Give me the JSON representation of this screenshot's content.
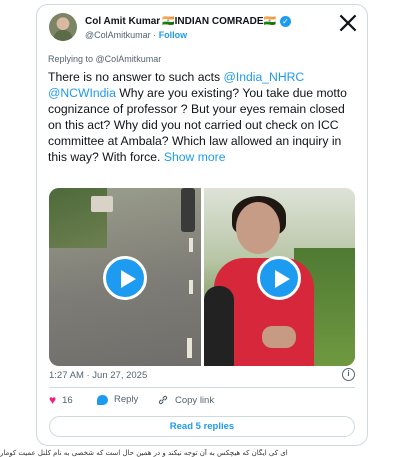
{
  "author": {
    "display_name": "Col Amit Kumar",
    "badge_text": "🇮🇳INDIAN COMRADE🇮🇳",
    "verified_symbol": "✓",
    "handle": "@ColAmitkumar",
    "separator": "·",
    "follow_label": "Follow",
    "avatar_icon": "avatar-person"
  },
  "platform_icon": "x-logo-icon",
  "replying": {
    "prefix": "Replying to",
    "target": "@ColAmitkumar"
  },
  "tweet": {
    "part1": "There is no answer to such acts ",
    "mention1": "@India_NHRC",
    "space": " ",
    "mention2": "@NCWIndia",
    "part2": " Why are you existing? You take due motto cognizance of professor ? But your eyes remain closed on this act? Why did you not carried out check on ICC committee at Ambala? Which law allowed an inquiry in this way? With force. ",
    "show_more": "Show more"
  },
  "media": {
    "video_count": 2,
    "play_icon": "play-icon"
  },
  "timestamp": "1:27 AM · Jun 27, 2025",
  "info_icon": "info-icon",
  "actions": {
    "like_count": "16",
    "reply_label": "Reply",
    "copy_label": "Copy link"
  },
  "read_replies_label": "Read 5 replies",
  "bottom_text": "ای کی ایگان که هیچکس به آن توجه نیکند و در همین حال است که شخصی به نام کلنل عمیت کومار"
}
